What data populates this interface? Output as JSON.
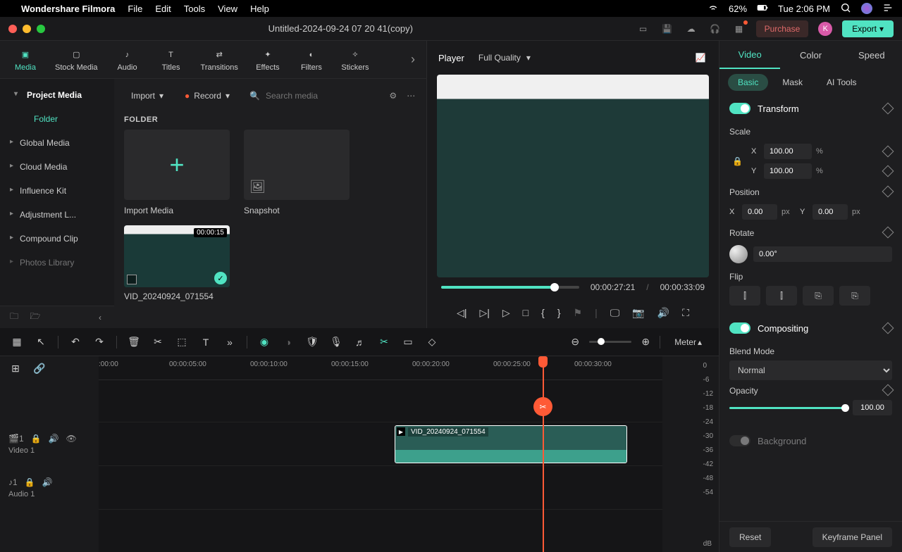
{
  "menubar": {
    "app": "Wondershare Filmora",
    "items": [
      "File",
      "Edit",
      "Tools",
      "View",
      "Help"
    ],
    "battery": "62%",
    "clock": "Tue 2:06 PM"
  },
  "titlebar": {
    "title": "Untitled-2024-09-24 07 20 41(copy)",
    "purchase": "Purchase",
    "export": "Export",
    "avatar": "K"
  },
  "tabs": [
    "Media",
    "Stock Media",
    "Audio",
    "Titles",
    "Transitions",
    "Effects",
    "Filters",
    "Stickers"
  ],
  "sidebar": {
    "header": "Project Media",
    "active": "Folder",
    "items": [
      "Global Media",
      "Cloud Media",
      "Influence Kit",
      "Adjustment L...",
      "Compound Clip",
      "Photos Library"
    ]
  },
  "media": {
    "import": "Import",
    "record": "Record",
    "search_ph": "Search media",
    "folder_label": "FOLDER",
    "tiles": {
      "import_media": "Import Media",
      "snapshot": "Snapshot"
    },
    "clip": {
      "name": "VID_20240924_071554",
      "duration": "00:00:15"
    }
  },
  "player": {
    "label": "Player",
    "quality": "Full Quality",
    "current": "00:00:27:21",
    "total": "00:00:33:09"
  },
  "inspector": {
    "tabs": [
      "Video",
      "Color",
      "Speed"
    ],
    "subtabs": [
      "Basic",
      "Mask",
      "AI Tools"
    ],
    "transform": "Transform",
    "scale": {
      "label": "Scale",
      "x": "100.00",
      "y": "100.00",
      "unit": "%"
    },
    "position": {
      "label": "Position",
      "x": "0.00",
      "y": "0.00",
      "unit": "px"
    },
    "rotate": {
      "label": "Rotate",
      "value": "0.00°"
    },
    "flip": "Flip",
    "compositing": "Compositing",
    "blend": {
      "label": "Blend Mode",
      "value": "Normal"
    },
    "opacity": {
      "label": "Opacity",
      "value": "100.00"
    },
    "background": "Background",
    "reset": "Reset",
    "keyframe": "Keyframe Panel"
  },
  "timeline": {
    "meter": "Meter",
    "ticks": [
      ":00:00",
      "00:00:05:00",
      "00:00:10:00",
      "00:00:15:00",
      "00:00:20:00",
      "00:00:25:00",
      "00:00:30:00"
    ],
    "video_track": "Video 1",
    "audio_track": "Audio 1",
    "clip_name": "VID_20240924_071554",
    "meter_vals": [
      "0",
      "-6",
      "-12",
      "-18",
      "-24",
      "-30",
      "-36",
      "-42",
      "-48",
      "-54"
    ],
    "meter_unit": "dB"
  }
}
